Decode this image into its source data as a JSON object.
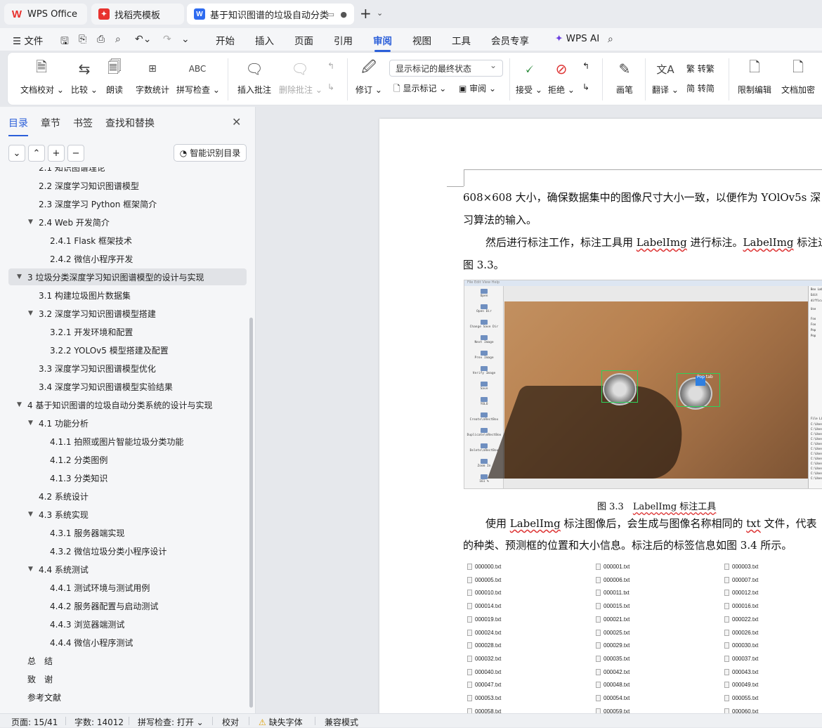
{
  "tabs": [
    {
      "label": "WPS Office",
      "icon": "wps-logo-icon"
    },
    {
      "label": "找稻壳模板",
      "icon": "docer-icon"
    },
    {
      "label": "基于知识图谱的垃圾自动分类系统",
      "icon": "word-doc-icon"
    }
  ],
  "menu": {
    "file": "文件",
    "items": [
      "开始",
      "插入",
      "页面",
      "引用",
      "审阅",
      "视图",
      "工具",
      "会员专享"
    ],
    "active": "审阅",
    "wps_ai": "WPS AI"
  },
  "ribbon": {
    "doc_check": "文档校对",
    "compare": "比较",
    "read_aloud": "朗读",
    "word_count": "字数统计",
    "spell_check": "拼写检查",
    "spell_icon_text": "ABC",
    "insert_comment": "插入批注",
    "delete_comment": "删除批注",
    "track_changes": "修订",
    "markup_select": "显示标记的最终状态",
    "show_markup": "显示标记",
    "review": "审阅",
    "accept": "接受",
    "reject": "拒绝",
    "pen": "画笔",
    "translate": "翻译",
    "to_traditional": "转繁",
    "to_simplified": "转简",
    "restrict_edit": "限制编辑",
    "doc_encrypt": "文档加密"
  },
  "sidebar": {
    "tabs": [
      "目录",
      "章节",
      "书签",
      "查找和替换"
    ],
    "active_tab": "目录",
    "smart_toc": "智能识别目录",
    "toc": [
      {
        "label": "2.1 知识图谱理论",
        "level": 2,
        "arrow": ""
      },
      {
        "label": "2.2  深度学习知识图谱模型",
        "level": 2,
        "arrow": ""
      },
      {
        "label": "2.3  深度学习 Python 框架简介",
        "level": 2,
        "arrow": ""
      },
      {
        "label": "2.4 Web 开发简介",
        "level": 2,
        "arrow": "▼"
      },
      {
        "label": "2.4.1 Flask 框架技术",
        "level": 3,
        "arrow": ""
      },
      {
        "label": "2.4.2  微信小程序开发",
        "level": 3,
        "arrow": ""
      },
      {
        "label": "3  垃圾分类深度学习知识图谱模型的设计与实现",
        "level": 1,
        "arrow": "▼",
        "selected": true
      },
      {
        "label": "3.1  构建垃圾图片数据集",
        "level": 2,
        "arrow": ""
      },
      {
        "label": "3.2  深度学习知识图谱模型搭建",
        "level": 2,
        "arrow": "▼"
      },
      {
        "label": "3.2.1  开发环境和配置",
        "level": 3,
        "arrow": ""
      },
      {
        "label": "3.2.2 YOLOv5 模型搭建及配置",
        "level": 3,
        "arrow": ""
      },
      {
        "label": "3.3  深度学习知识图谱模型优化",
        "level": 2,
        "arrow": ""
      },
      {
        "label": "3.4  深度学习知识图谱模型实验结果",
        "level": 2,
        "arrow": ""
      },
      {
        "label": "4  基于知识图谱的垃圾自动分类系统的设计与实现",
        "level": 1,
        "arrow": "▼"
      },
      {
        "label": "4.1  功能分析",
        "level": 2,
        "arrow": "▼"
      },
      {
        "label": "4.1.1  拍照或图片智能垃圾分类功能",
        "level": 3,
        "arrow": ""
      },
      {
        "label": "4.1.2  分类图例",
        "level": 3,
        "arrow": ""
      },
      {
        "label": "4.1.3  分类知识",
        "level": 3,
        "arrow": ""
      },
      {
        "label": "4.2  系统设计",
        "level": 2,
        "arrow": ""
      },
      {
        "label": "4.3  系统实现",
        "level": 2,
        "arrow": "▼"
      },
      {
        "label": "4.3.1  服务器端实现",
        "level": 3,
        "arrow": ""
      },
      {
        "label": "4.3.2  微信垃圾分类小程序设计",
        "level": 3,
        "arrow": ""
      },
      {
        "label": "4.4  系统测试",
        "level": 2,
        "arrow": "▼"
      },
      {
        "label": "4.4.1  测试环境与测试用例",
        "level": 3,
        "arrow": ""
      },
      {
        "label": "4.4.2  服务器配置与启动测试",
        "level": 3,
        "arrow": ""
      },
      {
        "label": "4.4.3  浏览器端测试",
        "level": 3,
        "arrow": ""
      },
      {
        "label": "4.4.4  微信小程序测试",
        "level": 3,
        "arrow": ""
      },
      {
        "label": "总　结",
        "level": 1,
        "arrow": ""
      },
      {
        "label": "致　谢",
        "level": 1,
        "arrow": ""
      },
      {
        "label": "参考文献",
        "level": 1,
        "arrow": ""
      }
    ]
  },
  "document": {
    "p1a": "608×608 大小，确保数据集中的图像尺寸大小一致，以便作为 YOlOv5s 深",
    "p1b": "习算法的输入。",
    "p2a_1": "然后进行标注工作，标注工具用 ",
    "p2a_2": "LabelImg",
    "p2a_3": " 进行标注。",
    "p2a_4": "LabelImg",
    "p2a_5": " 标注过",
    "p2b": "图 3.3。",
    "caption_num": "图 3.3",
    "caption_text": "LabelImg 标注工具",
    "p3a_1": "使用 ",
    "p3a_2": "LabelImg",
    "p3a_3": " 标注图像后，会生成与图像名称相同的 ",
    "p3a_4": "txt",
    "p3a_5": " 文件，代表",
    "p3b": "的种类、预测框的位置和大小信息。标注后的标签信息如图 3.4 所示。",
    "labelimg": {
      "menu": "File  Edit  View  Help",
      "tools": [
        "Open",
        "Open Dir",
        "Change Save Dir",
        "Next Image",
        "Prev Image",
        "Verify Image",
        "Save",
        "YOLO",
        "Create\\nRectBox",
        "Duplicate\\nRectBox",
        "Delete\\nRectBox",
        "Zoom In",
        "161 %"
      ],
      "right_panel": [
        "Box Lab",
        "Edit",
        "difficult",
        "Use",
        "Foo",
        "Foo",
        "Pop",
        "Pop",
        "File Li",
        "C:\\User",
        "C:\\User",
        "C:\\User",
        "C:\\User",
        "C:\\User",
        "C:\\User",
        "C:\\User",
        "C:\\User",
        "C:\\User",
        "C:\\User",
        "C:\\User",
        "C:\\User"
      ],
      "box_label": "Pop tab"
    },
    "files": [
      [
        "000000.txt",
        "000001.txt",
        "000003.txt"
      ],
      [
        "000005.txt",
        "000006.txt",
        "000007.txt"
      ],
      [
        "000010.txt",
        "000011.txt",
        "000012.txt"
      ],
      [
        "000014.txt",
        "000015.txt",
        "000016.txt"
      ],
      [
        "000019.txt",
        "000021.txt",
        "000022.txt"
      ],
      [
        "000024.txt",
        "000025.txt",
        "000026.txt"
      ],
      [
        "000028.txt",
        "000029.txt",
        "000030.txt"
      ],
      [
        "000032.txt",
        "000035.txt",
        "000037.txt"
      ],
      [
        "000040.txt",
        "000042.txt",
        "000043.txt"
      ],
      [
        "000047.txt",
        "000048.txt",
        "000049.txt"
      ],
      [
        "000053.txt",
        "000054.txt",
        "000055.txt"
      ],
      [
        "000058.txt",
        "000059.txt",
        "000060.txt"
      ]
    ]
  },
  "status": {
    "page": "页面: 15/41",
    "words": "字数: 14012",
    "spell": "拼写检查: 打开",
    "proof": "校对",
    "missing_font": "缺失字体",
    "compat": "兼容模式"
  },
  "colors": {
    "accent": "#2b5fd9",
    "wps_red": "#e8322e",
    "word_blue": "#2e6bf0"
  }
}
